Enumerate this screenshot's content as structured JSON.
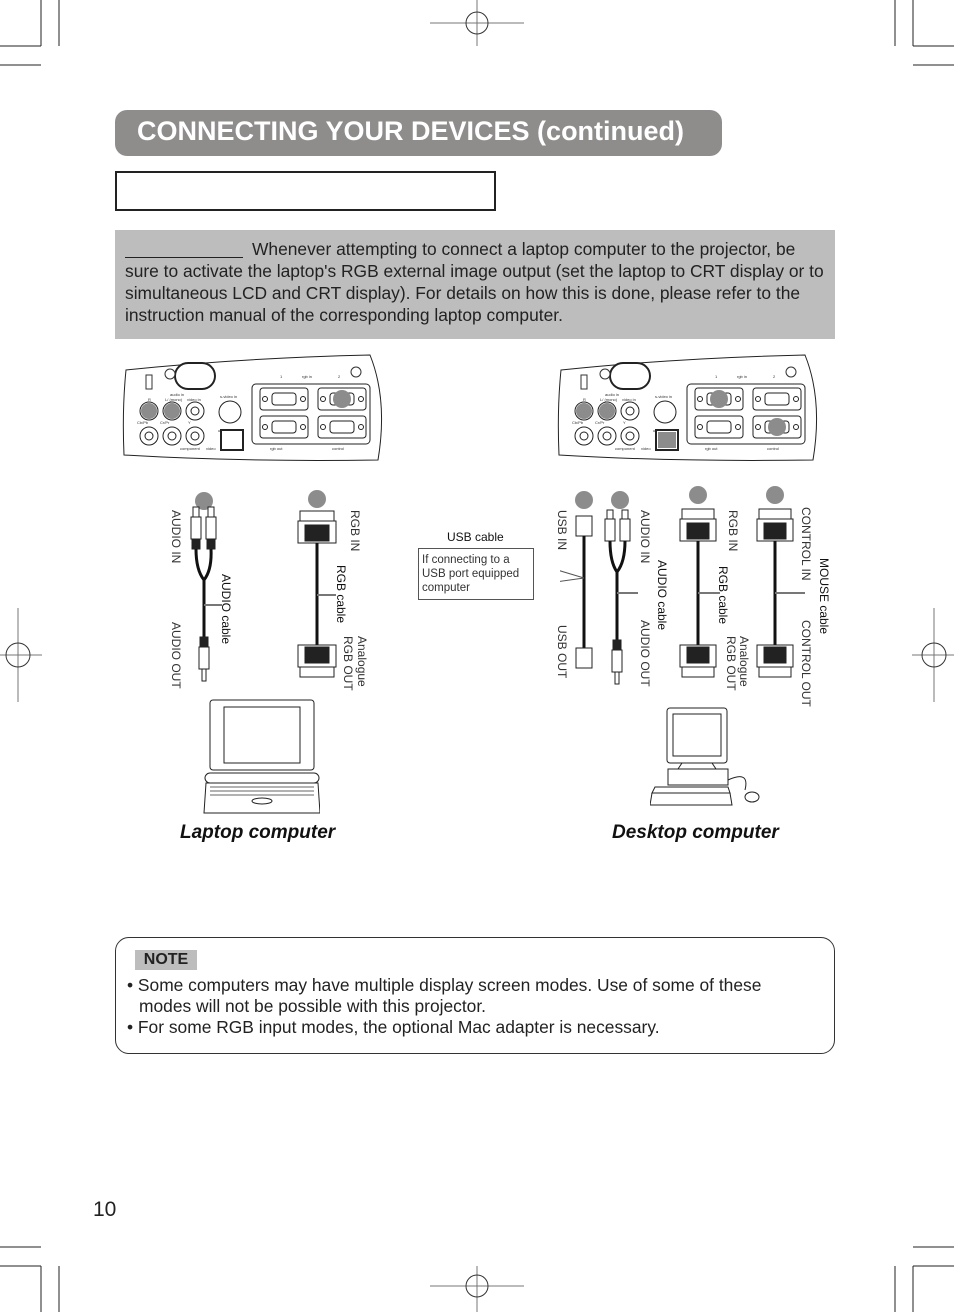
{
  "page": {
    "title": "CONNECTING YOUR DEVICES (continued)",
    "subheading": "",
    "page_number": "10"
  },
  "warning": {
    "lead_blank": "",
    "text": "Whenever attempting to connect a laptop computer to the projector, be sure to activate the laptop's RGB external image output (set the laptop to CRT display or to simultaneous LCD and CRT display). For details on how this is done, please refer to the instruction manual of the corresponding laptop computer."
  },
  "projector_panel": {
    "labels": {
      "audio_in": "audio in",
      "r": "R",
      "l_mono": "L/ (mono)",
      "video_in": "video in",
      "s_video_in": "s-video in",
      "cb_pb": "Cb/Pb",
      "cr_pr": "Cr/Pr",
      "y": "Y",
      "component": "component",
      "video": "video",
      "rgb_in": "rgb in",
      "port1": "1",
      "port2": "2",
      "rgb_out": "rgb out",
      "control": "control",
      "usb": "usb"
    }
  },
  "laptop": {
    "caption": "Laptop computer",
    "audio": {
      "in_label": "AUDIO IN",
      "cable_label": "AUDIO cable",
      "out_label": "AUDIO OUT"
    },
    "rgb": {
      "in_label": "RGB IN",
      "cable_label": "RGB cable",
      "out_label_1": "Analogue",
      "out_label_2": "RGB OUT"
    }
  },
  "desktop": {
    "caption": "Desktop computer",
    "usb": {
      "title": "USB cable",
      "callout": "If connecting to a USB port equipped computer",
      "in_label": "USB IN",
      "out_label": "USB OUT"
    },
    "audio": {
      "in_label": "AUDIO IN",
      "cable_label": "AUDIO cable",
      "out_label": "AUDIO OUT"
    },
    "rgb": {
      "in_label": "RGB IN",
      "cable_label": "RGB cable",
      "out_label_1": "Analogue",
      "out_label_2": "RGB OUT"
    },
    "mouse": {
      "in_label": "CONTROL IN",
      "cable_label": "MOUSE cable",
      "out_label": "CONTROL OUT"
    }
  },
  "note": {
    "tag": "NOTE",
    "items": [
      "• Some computers may have multiple display screen modes. Use of some of these",
      "modes will not be possible with this projector.",
      "• For some RGB input modes, the optional Mac adapter is necessary."
    ]
  },
  "colors": {
    "title_bg": "#8f8c8c",
    "warning_bg": "#bdbdbd",
    "marker_gray": "#8c8c8c"
  }
}
